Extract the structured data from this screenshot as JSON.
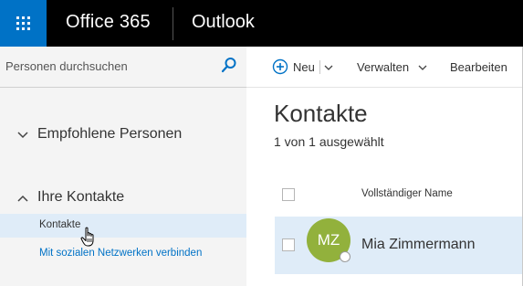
{
  "topbar": {
    "brand": "Office 365",
    "app_name": "Outlook",
    "colors": {
      "background": "#000000",
      "waffle": "#0072c6"
    }
  },
  "left_pane": {
    "search": {
      "placeholder": "Personen durchsuchen",
      "value": ""
    },
    "groups": [
      {
        "label": "Empfohlene Personen",
        "expanded": false
      },
      {
        "label": "Ihre Kontakte",
        "expanded": true,
        "items": [
          {
            "label": "Kontakte",
            "selected": true
          }
        ]
      }
    ],
    "social_link": "Mit sozialen Netzwerken verbinden"
  },
  "toolbar": {
    "new_label": "Neu",
    "manage_label": "Verwalten",
    "edit_label": "Bearbeiten"
  },
  "main": {
    "title": "Kontakte",
    "selection_status": "1 von 1 ausgewählt",
    "list": {
      "column_header": "Vollständiger Name",
      "rows": [
        {
          "initials": "MZ",
          "name": "Mia Zimmermann",
          "selected": true,
          "avatar_color": "#92b13c"
        }
      ]
    }
  },
  "colors": {
    "accent": "#0072c6",
    "selection": "#dfecf8",
    "pane_bg": "#f4f4f4"
  }
}
